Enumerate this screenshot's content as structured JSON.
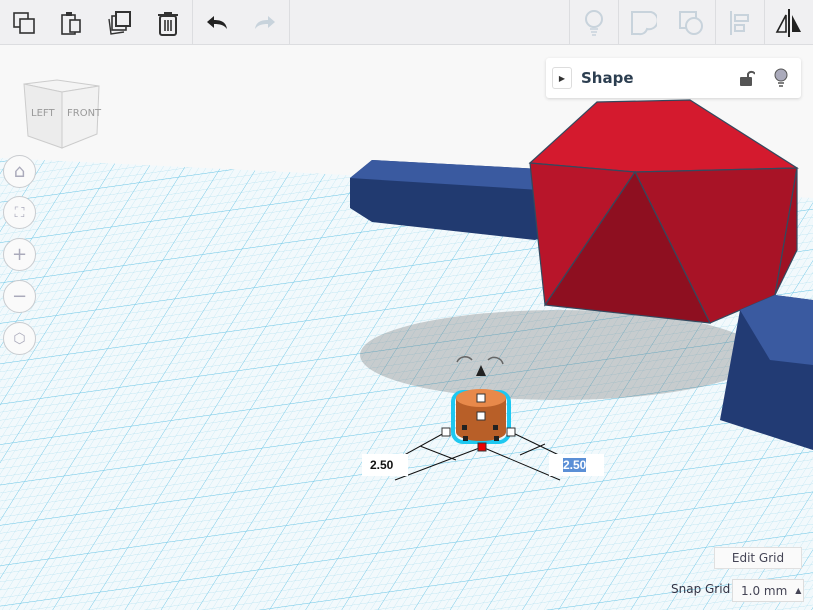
{
  "toolbar": {
    "items": [
      {
        "name": "copy-icon"
      },
      {
        "name": "paste-icon"
      },
      {
        "name": "duplicate-icon"
      },
      {
        "name": "delete-icon"
      },
      {
        "name": "undo-icon"
      },
      {
        "name": "redo-icon"
      },
      {
        "name": "lightbulb-icon"
      },
      {
        "name": "group-icon"
      },
      {
        "name": "ungroup-icon"
      },
      {
        "name": "align-icon"
      },
      {
        "name": "mirror-icon"
      }
    ]
  },
  "view_cube": {
    "left": "LEFT",
    "front": "FRONT"
  },
  "shape_panel": {
    "title": "Shape"
  },
  "dimensions": {
    "width": "2.50",
    "length": "2.50"
  },
  "grid": {
    "edit_label": "Edit Grid",
    "snap_label": "Snap Grid",
    "snap_value": "1.0 mm"
  },
  "colors": {
    "grid_line": "#8fd3ea",
    "cylinder": "#c8692e",
    "selection": "#1ec8f0",
    "blue_box": "#2b4a8c",
    "red_shape": "#c0182c"
  }
}
